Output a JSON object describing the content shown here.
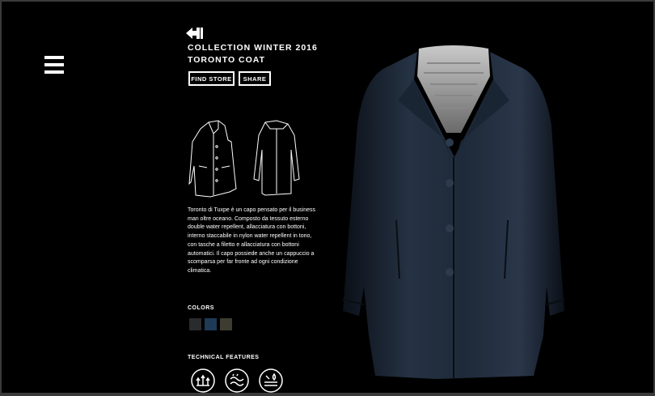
{
  "header": {
    "collection": "COLLECTION WINTER 2016",
    "product": "TORONTO COAT"
  },
  "buttons": {
    "find_store": "FIND STORE",
    "share": "SHARE"
  },
  "description": "Toronto di Tuxpe è un capo pensato per il business man oltre oceano. Composto da tessuto esterno double water repellent, allacciatura con bottoni, interno staccabile in nylon water repellent in tono, con tasche a filetto e allacciatura con bottoni automatici. Il capo possiede anche un cappuccio a scomparsa per far fronte ad ogni condizione climatica.",
  "colors": {
    "label": "COLORS",
    "swatches": [
      "#2a2b2c",
      "#1f3a56",
      "#3c3d30"
    ]
  },
  "technical": {
    "label": "TECHNICAL FEATURES",
    "icons": [
      "insulation-icon",
      "water-repellent-icon",
      "breathable-icon"
    ]
  },
  "theme": {
    "background": "#000000",
    "text": "#ffffff"
  }
}
